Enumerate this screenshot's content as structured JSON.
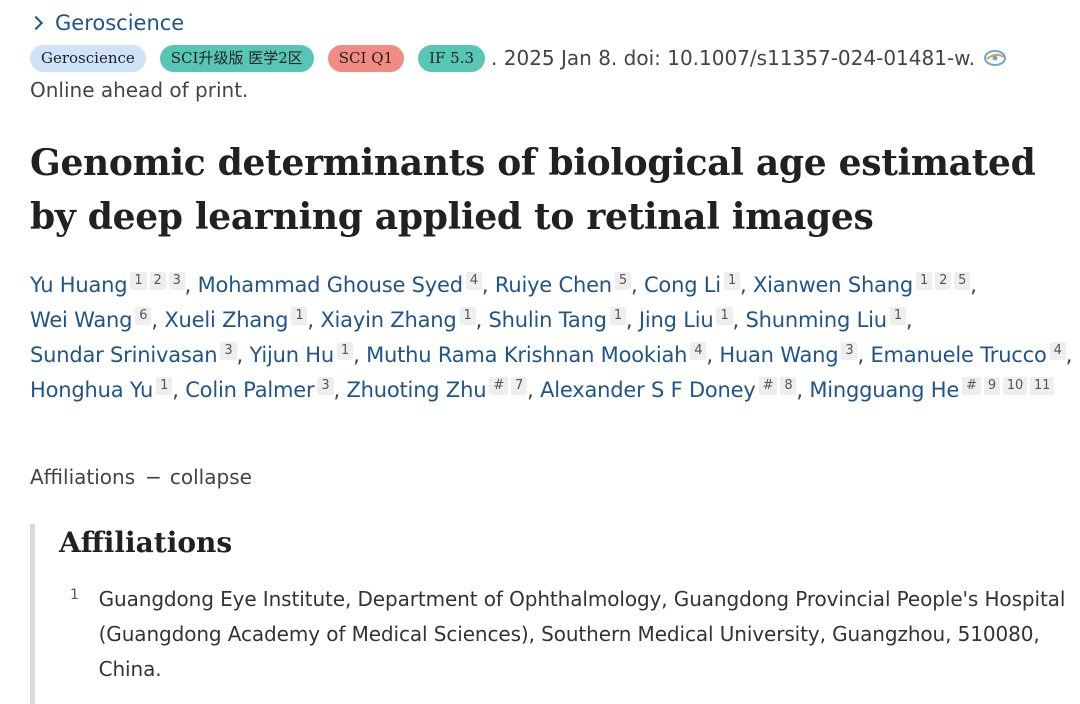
{
  "journal": {
    "link_label": "Geroscience"
  },
  "badges": [
    {
      "label": "Geroscience",
      "color": "#cfe2f7"
    },
    {
      "label": "SCI升级版 医学2区",
      "color": "#58c6b4"
    },
    {
      "label": "SCI Q1",
      "color": "#f28b82"
    },
    {
      "label": "IF 5.3",
      "color": "#58c6b4"
    }
  ],
  "citation": ". 2025 Jan 8. doi: 10.1007/s11357-024-01481-w.",
  "status_note": "Online ahead of print.",
  "title": "Genomic determinants of biological age estimated by deep learning applied to retinal images",
  "authors": [
    {
      "name": "Yu Huang",
      "affs": [
        "1",
        "2",
        "3"
      ]
    },
    {
      "name": "Mohammad Ghouse Syed",
      "affs": [
        "4"
      ]
    },
    {
      "name": "Ruiye Chen",
      "affs": [
        "5"
      ]
    },
    {
      "name": "Cong Li",
      "affs": [
        "1"
      ]
    },
    {
      "name": "Xianwen Shang",
      "affs": [
        "1",
        "2",
        "5"
      ]
    },
    {
      "name": "Wei Wang",
      "affs": [
        "6"
      ]
    },
    {
      "name": "Xueli Zhang",
      "affs": [
        "1"
      ]
    },
    {
      "name": "Xiayin Zhang",
      "affs": [
        "1"
      ]
    },
    {
      "name": "Shulin Tang",
      "affs": [
        "1"
      ]
    },
    {
      "name": "Jing Liu",
      "affs": [
        "1"
      ]
    },
    {
      "name": "Shunming Liu",
      "affs": [
        "1"
      ]
    },
    {
      "name": "Sundar Srinivasan",
      "affs": [
        "3"
      ]
    },
    {
      "name": "Yijun Hu",
      "affs": [
        "1"
      ]
    },
    {
      "name": "Muthu Rama Krishnan Mookiah",
      "affs": [
        "4"
      ]
    },
    {
      "name": "Huan Wang",
      "affs": [
        "3"
      ]
    },
    {
      "name": "Emanuele Trucco",
      "affs": [
        "4"
      ]
    },
    {
      "name": "Honghua Yu",
      "affs": [
        "1"
      ]
    },
    {
      "name": "Colin Palmer",
      "affs": [
        "3"
      ]
    },
    {
      "name": "Zhuoting Zhu",
      "affs": [
        "#",
        "7"
      ]
    },
    {
      "name": "Alexander S F Doney",
      "affs": [
        "#",
        "8"
      ]
    },
    {
      "name": "Mingguang He",
      "affs": [
        "#",
        "9",
        "10",
        "11"
      ]
    }
  ],
  "affiliations_toggle": {
    "label": "Affiliations",
    "dash": "−",
    "action": "collapse"
  },
  "affiliations": {
    "heading": "Affiliations",
    "items": [
      {
        "number": "1",
        "text": "Guangdong Eye Institute, Department of Ophthalmology, Guangdong Provincial People's Hospital (Guangdong Academy of Medical Sciences), Southern Medical University, Guangzhou, 510080, China."
      }
    ]
  },
  "icons": {
    "journal_chevron": "chevron-right-icon",
    "cite_icon": "citation-manager-icon"
  }
}
